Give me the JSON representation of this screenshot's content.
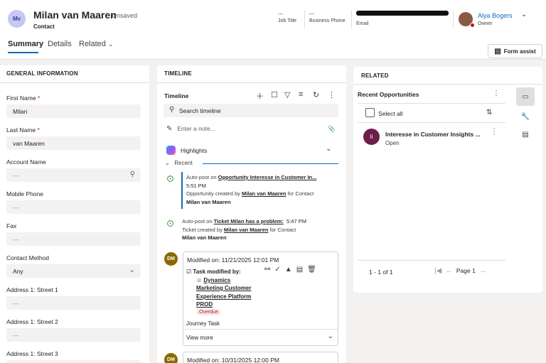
{
  "header": {
    "avatar_initials": "Mv",
    "record_name": "Milan van Maaren",
    "status": "- Unsaved",
    "entity_type": "Contact",
    "fields": [
      {
        "value": "---",
        "label": "Job Title"
      },
      {
        "value": "---",
        "label": "Business Phone"
      },
      {
        "value": "",
        "label": "Email"
      }
    ],
    "owner_name": "Alya Bogers",
    "owner_label": "Owner"
  },
  "tabs": [
    "Summary",
    "Details",
    "Related"
  ],
  "form_assist_label": "Form assist",
  "general": {
    "title": "GENERAL INFORMATION",
    "fields": [
      {
        "label": "First Name",
        "required": "*",
        "value": "Milan"
      },
      {
        "label": "Last Name",
        "required": "*",
        "value": "van Maaren"
      },
      {
        "label": "Account Name",
        "value": "---"
      },
      {
        "label": "Mobile Phone",
        "value": "---"
      },
      {
        "label": "Fax",
        "value": "---"
      },
      {
        "label": "Contact Method",
        "value": "Any"
      },
      {
        "label": "Address 1: Street 1",
        "value": "---"
      },
      {
        "label": "Address 1: Street 2",
        "value": "---"
      },
      {
        "label": "Address 1: Street 3",
        "value": ""
      }
    ]
  },
  "timeline": {
    "title": "TIMELINE",
    "header": "Timeline",
    "search_placeholder": "Search timeline",
    "note_placeholder": "Enter a note...",
    "highlights": "Highlights",
    "recent": "Recent",
    "posts": [
      {
        "prefix": "Auto-post on ",
        "link": "Opportunity Interesse in Customer In...",
        "time": "5:51 PM",
        "line2_a": "Opportunity created by ",
        "line2_link": "Milan van Maaren",
        "line2_b": " for Contact",
        "line3": "Milan van Maaren"
      },
      {
        "prefix": "Auto-post on ",
        "link": "Ticket Milan has a problem:",
        "time": "5:47 PM",
        "line2_a": "Ticket created by ",
        "line2_link": "Milan van Maaren",
        "line2_b": " for Contact",
        "line3": "Milan van Maaren"
      }
    ],
    "cards": [
      {
        "initials": "DM",
        "modified": "Modified on: 11/21/2025 12:01 PM",
        "task_label": "Task modified by:",
        "task_user_lines": [
          "Dynamics",
          "Marketing Customer",
          "Experience Platform",
          "PROD"
        ],
        "badge": "Overdue",
        "subject": "Journey Task",
        "view_more": "View more"
      },
      {
        "initials": "DM",
        "modified": "Modified on: 10/31/2025 12:00 PM"
      }
    ]
  },
  "related": {
    "title": "RELATED",
    "subgrid_title": "Recent Opportunities",
    "select_all": "Select all",
    "items": [
      {
        "initials": "Ii",
        "title": "Interesse in Customer Insights ...",
        "status": "Open"
      }
    ],
    "count": "1 - 1 of 1",
    "page": "Page 1"
  },
  "colors": {
    "accent": "#0f6cbd",
    "avatar_bg": "#c5c8f1",
    "dm_avatar": "#8a6a00",
    "opp_avatar": "#6b1f49",
    "overdue_bg": "#fde7e9"
  }
}
